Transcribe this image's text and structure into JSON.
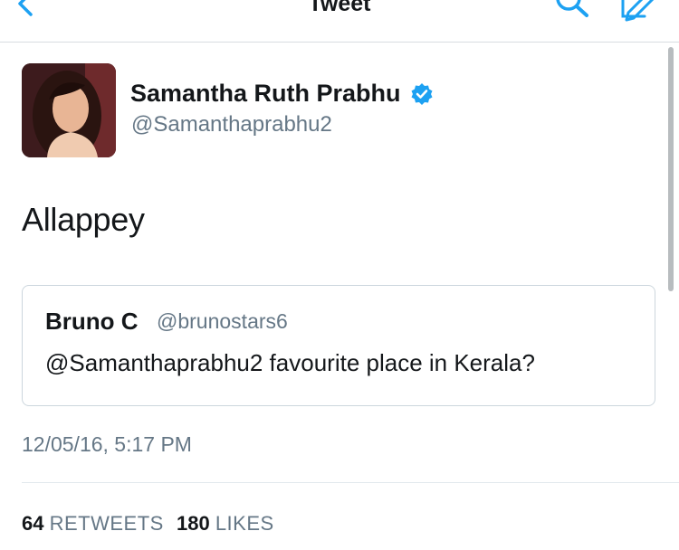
{
  "header": {
    "title": "Tweet"
  },
  "colors": {
    "accent": "#1da1f2",
    "secondary_text": "#657786",
    "border": "#ccd6dd"
  },
  "icons": {
    "back": "chevron-left",
    "search": "magnifier",
    "compose": "compose-pen",
    "verified": "verified-badge"
  },
  "tweet": {
    "author_name": "Samantha Ruth Prabhu",
    "author_handle": "@Samanthaprabhu2",
    "text": "Allappey",
    "timestamp": "12/05/16, 5:17 PM",
    "quoted": {
      "name": "Bruno C",
      "handle": "@brunostars6",
      "text": "@Samanthaprabhu2 favourite place in Kerala?"
    },
    "stats": {
      "retweets_count": "64",
      "retweets_label": "RETWEETS",
      "likes_count": "180",
      "likes_label": "LIKES"
    }
  }
}
